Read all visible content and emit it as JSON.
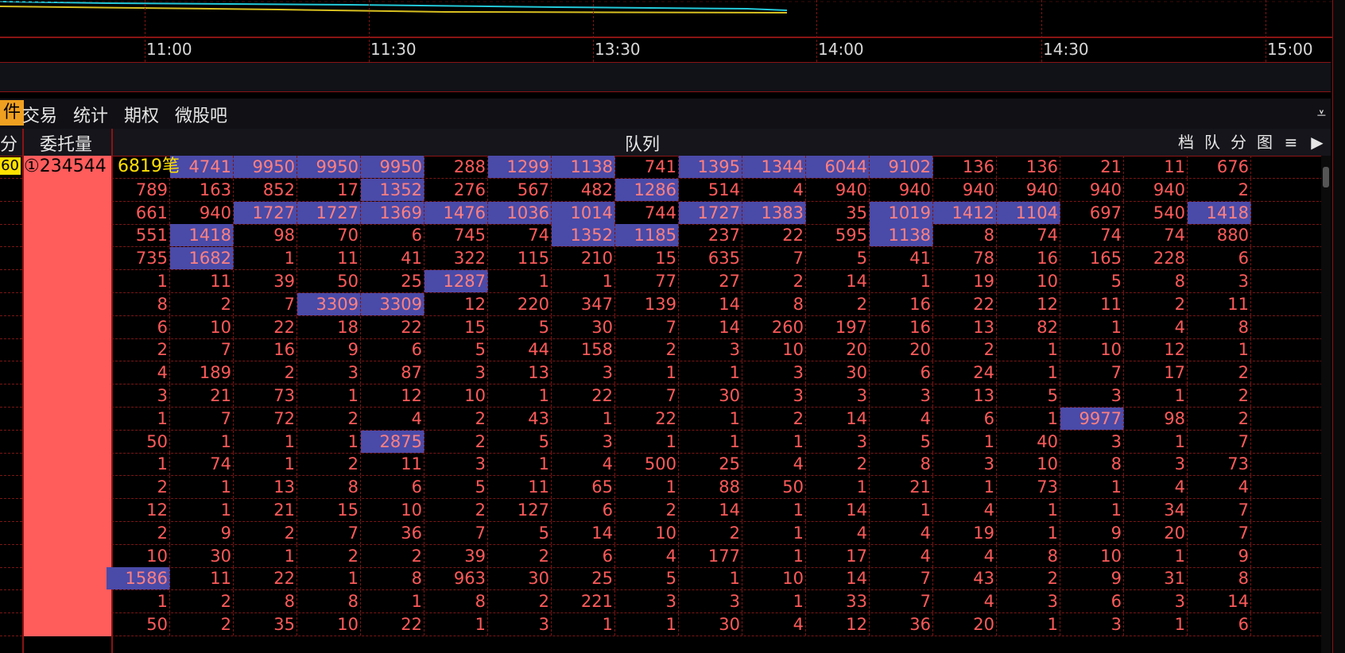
{
  "time_axis": {
    "labels": [
      "11:00",
      "11:30",
      "13:30",
      "14:00",
      "14:30",
      "15:00"
    ]
  },
  "colors": {
    "accent_tab": "#f0a020",
    "highlight_cell": "#4a4aa8",
    "grid_red": "#ff5a5a",
    "wt_column": "#ff5c5c",
    "yellow": "#ffe000",
    "line_cyan": "#22c8d8",
    "line_yellow": "#d8c020"
  },
  "tabs": [
    {
      "label": "件",
      "active": true
    },
    {
      "label": "交易",
      "active": false
    },
    {
      "label": "统计",
      "active": false
    },
    {
      "label": "期权",
      "active": false
    },
    {
      "label": "微股吧",
      "active": false
    }
  ],
  "collapse_icon": "collapse-down-icon",
  "header": {
    "left_cut": "分",
    "wt_label": "委托量",
    "queue_label": "队列",
    "buttons": [
      "档",
      "队",
      "分",
      "图",
      "≡",
      "▶"
    ]
  },
  "first_row": {
    "badge": "60",
    "order_no": "①",
    "order_qty": "234544",
    "count": "6819笔"
  },
  "rows": [
    [
      "",
      "4741*",
      "9950*",
      "9950*",
      "9950*",
      "288",
      "1299*",
      "1138*",
      "741",
      "1395*",
      "1344*",
      "6044*",
      "9102*",
      "136",
      "136",
      "21",
      "11",
      "676"
    ],
    [
      "789",
      "163",
      "852",
      "17",
      "1352*",
      "276",
      "567",
      "482",
      "1286*",
      "514",
      "4",
      "940",
      "940",
      "940",
      "940",
      "940",
      "940",
      "2"
    ],
    [
      "661",
      "940",
      "1727*",
      "1727*",
      "1369*",
      "1476*",
      "1036*",
      "1014*",
      "744",
      "1727*",
      "1383*",
      "35",
      "1019*",
      "1412*",
      "1104*",
      "697",
      "540",
      "1418*"
    ],
    [
      "551",
      "1418*",
      "98",
      "70",
      "6",
      "745",
      "74",
      "1352*",
      "1185*",
      "237",
      "22",
      "595",
      "1138*",
      "8",
      "74",
      "74",
      "74",
      "880"
    ],
    [
      "735",
      "1682*",
      "1",
      "11",
      "41",
      "322",
      "115",
      "210",
      "15",
      "635",
      "7",
      "5",
      "41",
      "78",
      "16",
      "165",
      "228",
      "6"
    ],
    [
      "1",
      "11",
      "39",
      "50",
      "25",
      "1287*",
      "1",
      "1",
      "77",
      "27",
      "2",
      "14",
      "1",
      "19",
      "10",
      "5",
      "8",
      "3"
    ],
    [
      "8",
      "2",
      "7",
      "3309*",
      "3309*",
      "12",
      "220",
      "347",
      "139",
      "14",
      "8",
      "2",
      "16",
      "22",
      "12",
      "11",
      "2",
      "11"
    ],
    [
      "6",
      "10",
      "22",
      "18",
      "22",
      "15",
      "5",
      "30",
      "7",
      "14",
      "260",
      "197",
      "16",
      "13",
      "82",
      "1",
      "4",
      "8"
    ],
    [
      "2",
      "7",
      "16",
      "9",
      "6",
      "5",
      "44",
      "158",
      "2",
      "3",
      "10",
      "20",
      "20",
      "2",
      "1",
      "10",
      "12",
      "1"
    ],
    [
      "4",
      "189",
      "2",
      "3",
      "87",
      "3",
      "13",
      "3",
      "1",
      "1",
      "3",
      "30",
      "6",
      "24",
      "1",
      "7",
      "17",
      "2"
    ],
    [
      "3",
      "21",
      "73",
      "1",
      "12",
      "10",
      "1",
      "22",
      "7",
      "30",
      "3",
      "3",
      "3",
      "13",
      "5",
      "3",
      "1",
      "2"
    ],
    [
      "1",
      "7",
      "72",
      "2",
      "4",
      "2",
      "43",
      "1",
      "22",
      "1",
      "2",
      "14",
      "4",
      "6",
      "1",
      "9977*",
      "98",
      "2"
    ],
    [
      "50",
      "1",
      "1",
      "1",
      "2875*",
      "2",
      "5",
      "3",
      "1",
      "1",
      "1",
      "3",
      "5",
      "1",
      "40",
      "3",
      "1",
      "7"
    ],
    [
      "1",
      "74",
      "1",
      "2",
      "11",
      "3",
      "1",
      "4",
      "500",
      "25",
      "4",
      "2",
      "8",
      "3",
      "10",
      "8",
      "3",
      "73"
    ],
    [
      "2",
      "1",
      "13",
      "8",
      "6",
      "5",
      "11",
      "65",
      "1",
      "88",
      "50",
      "1",
      "21",
      "1",
      "73",
      "1",
      "4",
      "4"
    ],
    [
      "12",
      "1",
      "21",
      "15",
      "10",
      "2",
      "127",
      "6",
      "2",
      "14",
      "1",
      "14",
      "1",
      "4",
      "1",
      "1",
      "34",
      "7"
    ],
    [
      "2",
      "9",
      "2",
      "7",
      "36",
      "7",
      "5",
      "14",
      "10",
      "2",
      "1",
      "4",
      "4",
      "19",
      "1",
      "9",
      "20",
      "7"
    ],
    [
      "10",
      "30",
      "1",
      "2",
      "2",
      "39",
      "2",
      "6",
      "4",
      "177",
      "1",
      "17",
      "4",
      "4",
      "8",
      "10",
      "1",
      "9"
    ],
    [
      "1586*",
      "11",
      "22",
      "1",
      "8",
      "963",
      "30",
      "25",
      "5",
      "1",
      "10",
      "14",
      "7",
      "43",
      "2",
      "9",
      "31",
      "8"
    ],
    [
      "1",
      "2",
      "8",
      "8",
      "1",
      "8",
      "2",
      "221",
      "3",
      "3",
      "1",
      "33",
      "7",
      "4",
      "3",
      "6",
      "3",
      "14"
    ],
    [
      "50",
      "2",
      "35",
      "10",
      "22",
      "1",
      "3",
      "1",
      "1",
      "30",
      "4",
      "12",
      "36",
      "20",
      "1",
      "3",
      "1",
      "6"
    ]
  ]
}
